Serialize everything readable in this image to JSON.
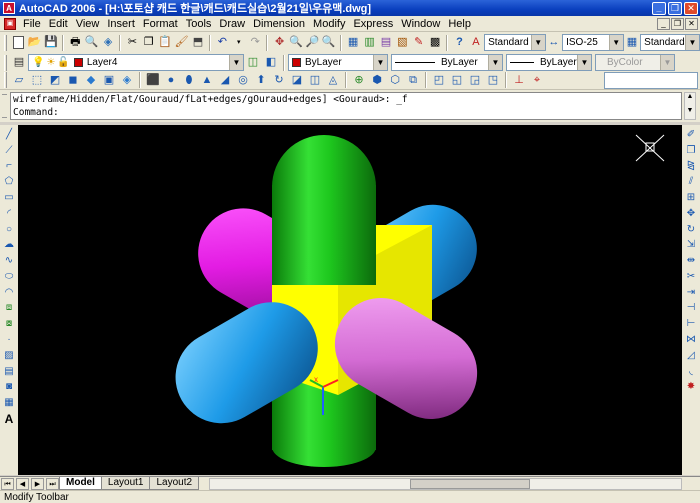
{
  "window": {
    "title": "AutoCAD 2006 - [H:\\포토샵 캐드 한글\\캐드\\캐드실습\\2월21일\\우유맥.dwg]",
    "app_icon": "autocad-a-icon"
  },
  "menu": {
    "items": [
      "File",
      "Edit",
      "View",
      "Insert",
      "Format",
      "Tools",
      "Draw",
      "Dimension",
      "Modify",
      "Express",
      "Window",
      "Help"
    ]
  },
  "toolbar_standard": {
    "text_style": "Standard",
    "dim_style": "ISO-25",
    "table_style": "Standard"
  },
  "toolbar_layers": {
    "layer": "Layer4",
    "layer_color": "#cc0000",
    "color_control": "ByLayer",
    "linetype_control": "ByLayer",
    "lineweight_control": "ByLayer",
    "plot_style": "ByColor"
  },
  "command": {
    "history": "wireframe/Hidden/Flat/Gouraud/fLat+edges/gOuraud+edges] <Gouraud>: _f",
    "prompt": "Command:"
  },
  "tabs": {
    "model": "Model",
    "layout1": "Layout1",
    "layout2": "Layout2"
  },
  "status": {
    "text": "Modify Toolbar"
  },
  "colors": {
    "green": "#1ec81e",
    "magenta": "#e31ce3",
    "cyan": "#1e9be8",
    "pink": "#d46cd4",
    "yellow": "#ffff00"
  }
}
